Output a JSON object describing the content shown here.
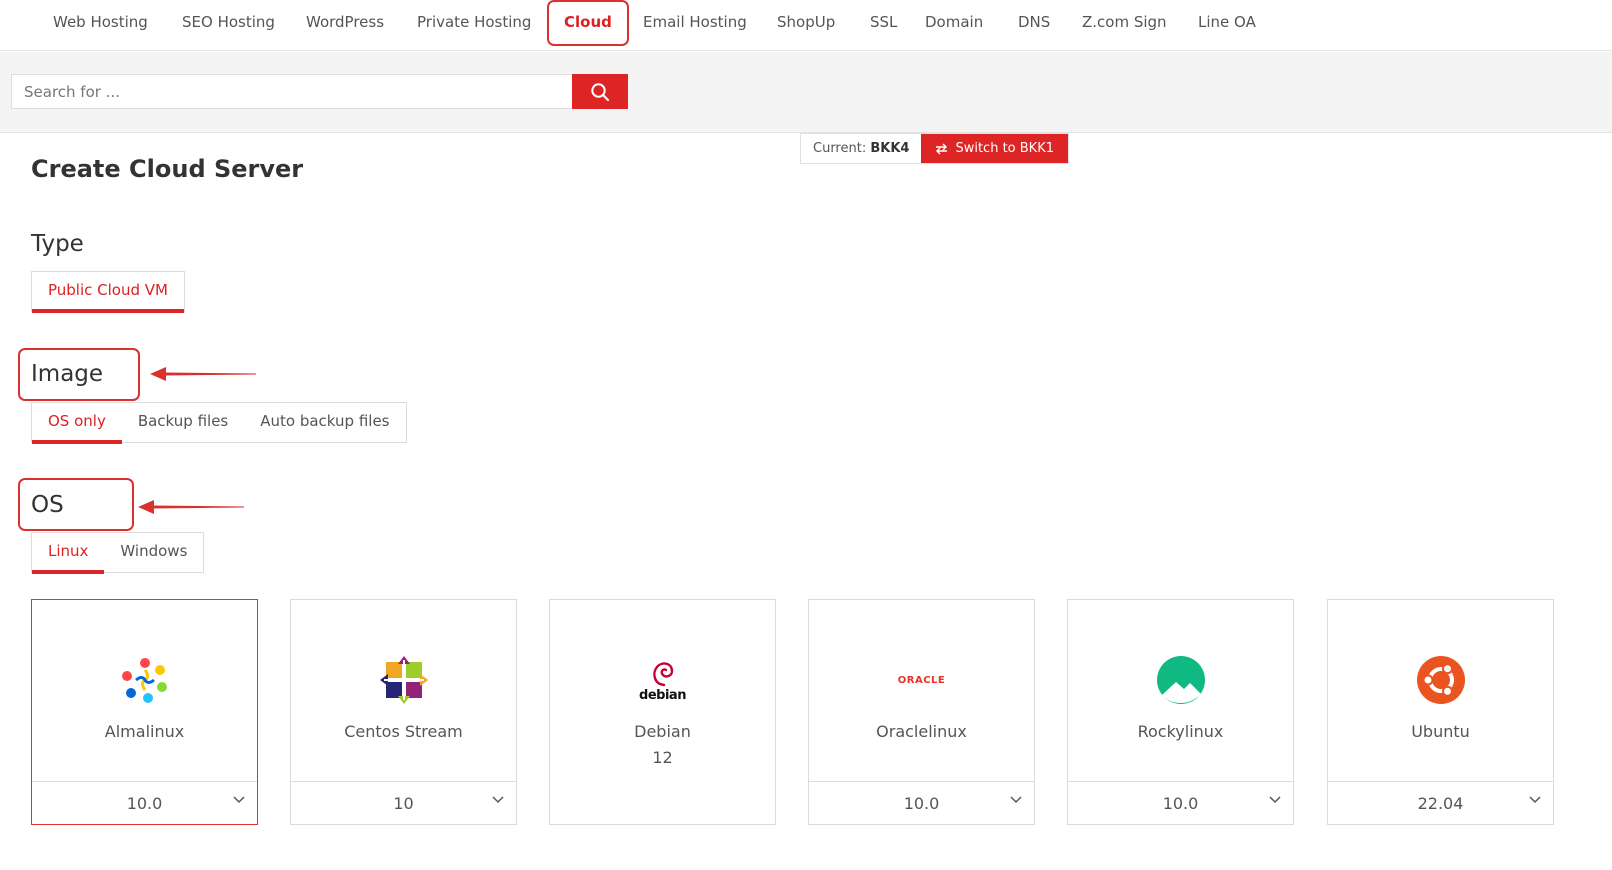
{
  "nav": {
    "items": [
      {
        "label": "Web Hosting"
      },
      {
        "label": "SEO Hosting"
      },
      {
        "label": "WordPress"
      },
      {
        "label": "Private Hosting"
      },
      {
        "label": "Cloud",
        "active": true
      },
      {
        "label": "Email Hosting"
      },
      {
        "label": "ShopUp"
      },
      {
        "label": "SSL"
      },
      {
        "label": "Domain"
      },
      {
        "label": "DNS"
      },
      {
        "label": "Z.com Sign"
      },
      {
        "label": "Line OA"
      }
    ]
  },
  "search": {
    "placeholder": "Search for ...",
    "button_icon": "search-icon"
  },
  "region": {
    "current_label": "Current:",
    "current_value": "BKK4",
    "switch_label": "Switch to BKK1",
    "switch_icon": "swap-arrows-icon"
  },
  "page": {
    "title": "Create Cloud Server"
  },
  "type_section": {
    "label": "Type",
    "tabs": [
      {
        "label": "Public Cloud VM",
        "active": true
      }
    ]
  },
  "image_section": {
    "label": "Image",
    "tabs": [
      {
        "label": "OS only",
        "active": true
      },
      {
        "label": "Backup files"
      },
      {
        "label": "Auto backup files"
      }
    ]
  },
  "os_section": {
    "label": "OS",
    "tabs": [
      {
        "label": "Linux",
        "active": true
      },
      {
        "label": "Windows"
      }
    ]
  },
  "os_cards": [
    {
      "name": "Almalinux",
      "version": "10.0",
      "dropdown": true,
      "selected": true,
      "icon": "almalinux-logo-icon"
    },
    {
      "name": "Centos Stream",
      "version": "10",
      "dropdown": true,
      "icon": "centos-logo-icon"
    },
    {
      "name": "Debian",
      "version": "12",
      "dropdown": false,
      "icon": "debian-logo-icon",
      "logo_text": "debian"
    },
    {
      "name": "Oraclelinux",
      "version": "10.0",
      "dropdown": true,
      "icon": "oracle-logo-icon",
      "logo_text": "ORACLE"
    },
    {
      "name": "Rockylinux",
      "version": "10.0",
      "dropdown": true,
      "icon": "rockylinux-logo-icon"
    },
    {
      "name": "Ubuntu",
      "version": "22.04",
      "dropdown": true,
      "icon": "ubuntu-logo-icon"
    }
  ],
  "colors": {
    "accent": "#dd2525",
    "highlight": "#d9322e",
    "border": "#dcdcdc",
    "band": "#f4f4f4"
  }
}
